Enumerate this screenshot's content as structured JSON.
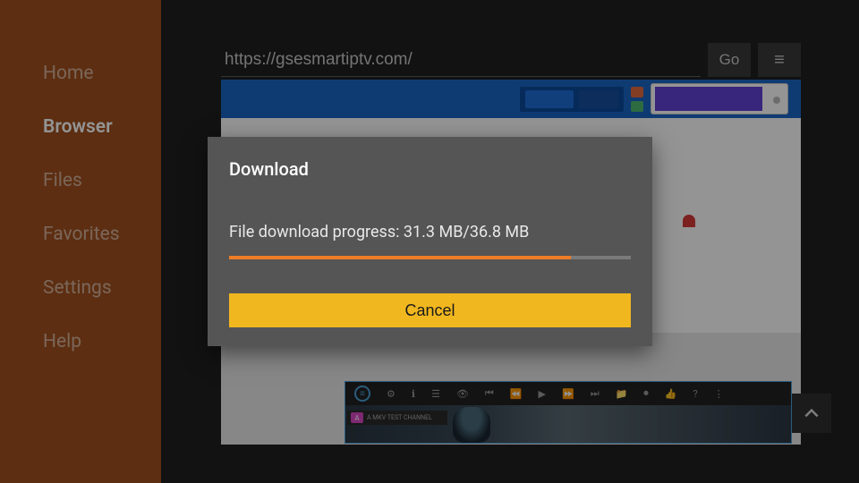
{
  "sidebar": {
    "items": [
      {
        "label": "Home"
      },
      {
        "label": "Browser"
      },
      {
        "label": "Files"
      },
      {
        "label": "Favorites"
      },
      {
        "label": "Settings"
      },
      {
        "label": "Help"
      }
    ],
    "active_index": 1
  },
  "urlbar": {
    "url": "https://gsesmartiptv.com/",
    "go_label": "Go",
    "menu_glyph": "≡"
  },
  "player": {
    "row_badge": "A",
    "row_text": "A MKV TEST CHANNEL"
  },
  "dialog": {
    "title": "Download",
    "progress_prefix": "File download progress: ",
    "downloaded": "31.3 MB",
    "total": "36.8 MB",
    "progress_text": "File download progress: 31.3 MB/36.8 MB",
    "progress_percent": 85,
    "cancel_label": "Cancel"
  },
  "colors": {
    "sidebar_bg": "#a0501e",
    "accent_orange": "#ee7d26",
    "accent_yellow": "#f0b71f",
    "dialog_bg": "#555555"
  }
}
